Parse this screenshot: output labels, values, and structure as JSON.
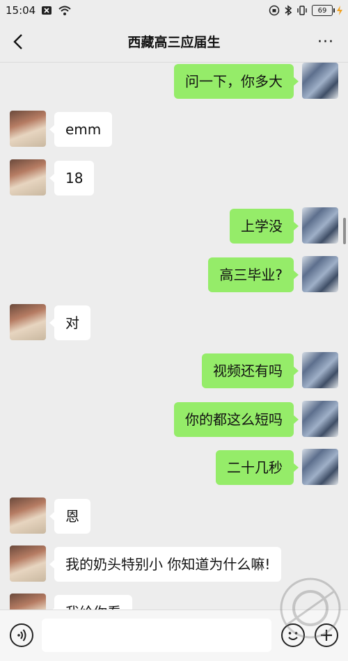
{
  "status": {
    "time": "15:04",
    "battery": "69"
  },
  "header": {
    "title": "西藏高三应届生",
    "more": "···"
  },
  "messages": [
    {
      "side": "right",
      "text": "问一下，你多大"
    },
    {
      "side": "left",
      "text": "emm"
    },
    {
      "side": "left",
      "text": "18"
    },
    {
      "side": "right",
      "text": "上学没"
    },
    {
      "side": "right",
      "text": "高三毕业?"
    },
    {
      "side": "left",
      "text": "对"
    },
    {
      "side": "right",
      "text": "视频还有吗"
    },
    {
      "side": "right",
      "text": "你的都这么短吗"
    },
    {
      "side": "right",
      "text": "二十几秒"
    },
    {
      "side": "left",
      "text": "恩"
    },
    {
      "side": "left",
      "text": "我的奶头特别小 你知道为什么嘛!"
    },
    {
      "side": "left",
      "text": "我给你看"
    }
  ],
  "icons": {
    "back": "chevron-left-icon",
    "more": "more-dots-icon",
    "voice": "voice-icon",
    "emoji": "emoji-icon",
    "plus": "plus-icon"
  },
  "colors": {
    "background": "#ededed",
    "bubble_self": "#95ec69",
    "bubble_other": "#ffffff"
  }
}
